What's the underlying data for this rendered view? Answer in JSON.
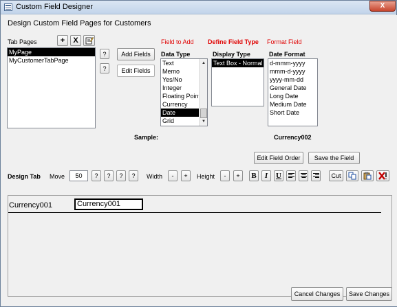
{
  "window": {
    "title": "Custom Field Designer",
    "close_glyph": "X"
  },
  "page_heading": "Design Custom Field Pages for Customers",
  "tab_pages": {
    "label": "Tab Pages",
    "add_glyph": "+",
    "remove_glyph": "X",
    "items": [
      {
        "label": "MyPage",
        "selected": true
      },
      {
        "label": "MyCustomerTabPage",
        "selected": false
      }
    ]
  },
  "help_buttons": {
    "q1": "?",
    "q2": "?"
  },
  "actions": {
    "add_fields": "Add Fields",
    "edit_fields": "Edit Fields"
  },
  "field_to_add": {
    "header": "Field to Add",
    "label": "Data Type",
    "items": [
      {
        "label": "Text",
        "selected": false
      },
      {
        "label": "Memo",
        "selected": false
      },
      {
        "label": "Yes/No",
        "selected": false
      },
      {
        "label": "Integer",
        "selected": false
      },
      {
        "label": "Floating Point",
        "selected": false
      },
      {
        "label": "Currency",
        "selected": false
      },
      {
        "label": "Date",
        "selected": true
      },
      {
        "label": "Grid",
        "selected": false
      }
    ]
  },
  "define_field_type": {
    "header": "Define Field Type",
    "label": "Display Type",
    "items": [
      {
        "label": "Text Box - Normal",
        "selected": true
      }
    ]
  },
  "format_field": {
    "header": "Format Field",
    "label": "Date Format",
    "items": [
      {
        "label": "d-mmm-yyyy"
      },
      {
        "label": "mmm-d-yyyy"
      },
      {
        "label": "yyyy-mm-dd"
      },
      {
        "label": "General Date"
      },
      {
        "label": "Long Date"
      },
      {
        "label": "Medium Date"
      },
      {
        "label": "Short Date"
      }
    ]
  },
  "sample": {
    "label": "Sample:",
    "value": "Currency002"
  },
  "buttons": {
    "edit_field_order": "Edit Field Order",
    "save_field": "Save the Field"
  },
  "design_toolbar": {
    "design_tab_label": "Design Tab",
    "move_label": "Move",
    "move_value": "50",
    "move_buttons": [
      "?",
      "?",
      "?",
      "?"
    ],
    "width_label": "Width",
    "width_minus": "-",
    "width_plus": "+",
    "height_label": "Height",
    "height_minus": "-",
    "height_plus": "+",
    "bold": "B",
    "italic": "I",
    "underline": "U",
    "cut": "Cut"
  },
  "design_area": {
    "field_label": "Currency001",
    "field_value": "Currency001"
  },
  "footer": {
    "cancel": "Cancel Changes",
    "save": "Save Changes"
  },
  "colors": {
    "accent_red": "#e00000",
    "selection": "#000000",
    "title_bar": "#c2d4ea"
  }
}
